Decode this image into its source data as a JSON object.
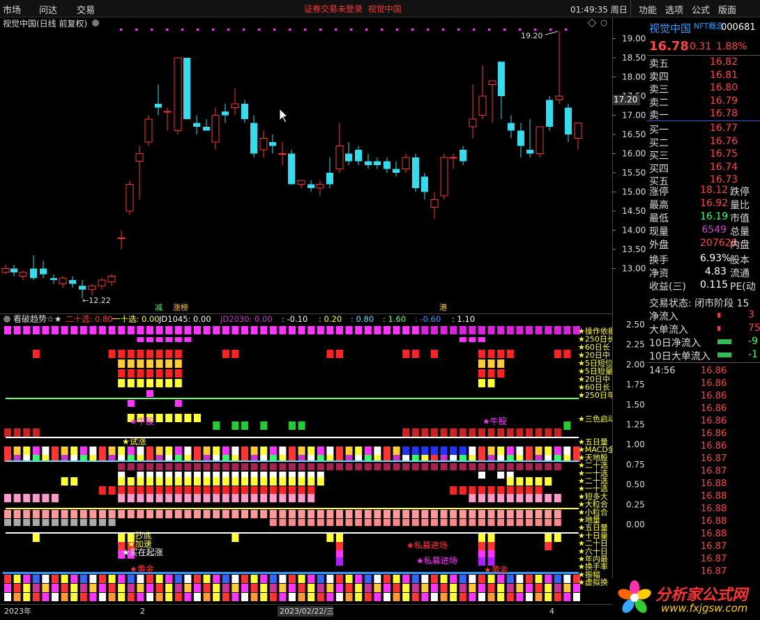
{
  "topbar": {
    "menus": [
      "市场",
      "问达",
      "交易"
    ],
    "notice": [
      "证券交易未登录",
      "视觉中国"
    ],
    "clock": "01:49:35 周日",
    "right_menus": [
      "功能",
      "选项",
      "公式",
      "版面"
    ]
  },
  "chart": {
    "title": "视觉中国(日线 前复权)",
    "price_ticks": [
      "19.00",
      "18.50",
      "18.00",
      "17.50",
      "17.00",
      "16.50",
      "16.00",
      "15.50",
      "15.00",
      "14.50",
      "14.00",
      "13.50",
      "13.00"
    ],
    "current_price_tag": "17.20",
    "high_label": "19.20",
    "low_label": "12.22",
    "event_labels": [
      "减",
      "涨榜",
      "港"
    ],
    "indicator_title": "看破趋势☆★",
    "indicator_params": [
      {
        "text": "二十选: 0.80",
        "color": "#ff3333"
      },
      {
        "text": "一十选: 0.00",
        "color": "#ffff33"
      },
      {
        "text": "JD1045: 0.00",
        "color": "#ffffff"
      },
      {
        "text": "JD2030: 0.00",
        "color": "#cc33cc"
      },
      {
        "text": ": -0.10",
        "color": "#ffffff"
      },
      {
        "text": ": 0.20",
        "color": "#ffff33"
      },
      {
        "text": ": 0.80",
        "color": "#66ddff"
      },
      {
        "text": ": 1.60",
        "color": "#66ff66"
      },
      {
        "text": ": -0.60",
        "color": "#3399ff"
      },
      {
        "text": ": 1.10",
        "color": "#ffffff"
      }
    ],
    "indicator_ticks": [
      "2.50",
      "2.25",
      "2.00",
      "1.75",
      "1.50",
      "1.25",
      "1.00",
      "0.75",
      "0.50",
      "0.25",
      "0.00"
    ],
    "right_labels": [
      "★操作依据",
      "★250日长",
      "★60日长",
      "★20日中",
      "★5日短位",
      "★5日短量",
      "★20日中",
      "★60日长",
      "★250日年",
      "★三色启动",
      "★五日量",
      "★MACD金",
      "★天地股",
      "★二十选",
      "★一十选",
      "★二十选",
      "★一十选",
      "★短多大",
      "★大粒合",
      "★小粒合",
      "★地量",
      "★五日量",
      "★十日量",
      "★二十日",
      "★六十日",
      "★年内最",
      "★换手率",
      "★振幅",
      "★虚拟换"
    ],
    "signal_labels": [
      {
        "text": "★牛股",
        "color": "#ff33ff"
      },
      {
        "text": "★牛股",
        "color": "#ff33ff"
      },
      {
        "text": "★试涨",
        "color": "#ffff33"
      },
      {
        "text": "★抄底",
        "color": "#ffff33"
      },
      {
        "text": "★加速",
        "color": "#ffff33"
      },
      {
        "text": "★买在起涨",
        "color": "#ffffff"
      },
      {
        "text": "★私募进场",
        "color": "#ff3333"
      },
      {
        "text": "★私募进场",
        "color": "#ff33ff"
      },
      {
        "text": "★黄金",
        "color": "#ff3333"
      },
      {
        "text": "★黄金",
        "color": "#ff3333"
      }
    ],
    "date_labels": [
      "2023年",
      "2",
      "2023/02/22/三",
      "4"
    ]
  },
  "quote": {
    "name": "视觉中国",
    "tag": "NFT概念",
    "code": "000681",
    "price": "16.78",
    "change": "0.31",
    "change_pct": "1.88%",
    "asks": [
      {
        "label": "卖五",
        "price": "16.82"
      },
      {
        "label": "卖四",
        "price": "16.81"
      },
      {
        "label": "卖三",
        "price": "16.80"
      },
      {
        "label": "卖二",
        "price": "16.79"
      },
      {
        "label": "卖一",
        "price": "16.78"
      }
    ],
    "bids": [
      {
        "label": "买一",
        "price": "16.77"
      },
      {
        "label": "买二",
        "price": "16.76"
      },
      {
        "label": "买三",
        "price": "16.75"
      },
      {
        "label": "买四",
        "price": "16.74"
      },
      {
        "label": "买五",
        "price": "16.73"
      }
    ],
    "stats": [
      {
        "label": "涨停",
        "value": "18.12",
        "vcolor": "#ff4444",
        "sub": "跌停"
      },
      {
        "label": "最高",
        "value": "16.92",
        "vcolor": "#ff4444",
        "sub": "量比"
      },
      {
        "label": "最低",
        "value": "16.19",
        "vcolor": "#33ff66",
        "sub": "市值"
      },
      {
        "label": "现量",
        "value": "6549",
        "vcolor": "#cc44cc",
        "sub": "总量"
      },
      {
        "label": "外盘",
        "value": "207628",
        "vcolor": "#ff4444",
        "sub": "内盘"
      }
    ],
    "stats2": [
      {
        "label": "换手",
        "value": "6.93%",
        "vcolor": "#ffffff",
        "sub": "股本"
      },
      {
        "label": "净资",
        "value": "4.83",
        "vcolor": "#ffffff",
        "sub": "流通"
      },
      {
        "label": "收益(三)",
        "value": "0.115",
        "vcolor": "#ffffff",
        "sub": "PE(动"
      }
    ],
    "trade_status": "交易状态: 闭市阶段 15",
    "flows": [
      {
        "label": "净流入",
        "value": "3",
        "bar": "#ff3333"
      },
      {
        "label": "大单流入",
        "value": "75",
        "bar": "#ff3333"
      },
      {
        "label": "10日净流入",
        "value": "-9",
        "bar": "#33bb55"
      },
      {
        "label": "10日大单流入",
        "value": "-1",
        "bar": "#33bb55"
      }
    ],
    "tick_time": "14:56",
    "ticks": [
      "16.86",
      "16.86",
      "16.86",
      "16.86",
      "16.86",
      "16.86",
      "16.86",
      "16.87",
      "16.87",
      "16.88",
      "16.88",
      "16.88",
      "16.88",
      "16.88",
      "16.87",
      "16.87",
      "16.87"
    ]
  },
  "logo": {
    "title": "分析家公式网",
    "url": "www.fxjgsw.com"
  }
}
